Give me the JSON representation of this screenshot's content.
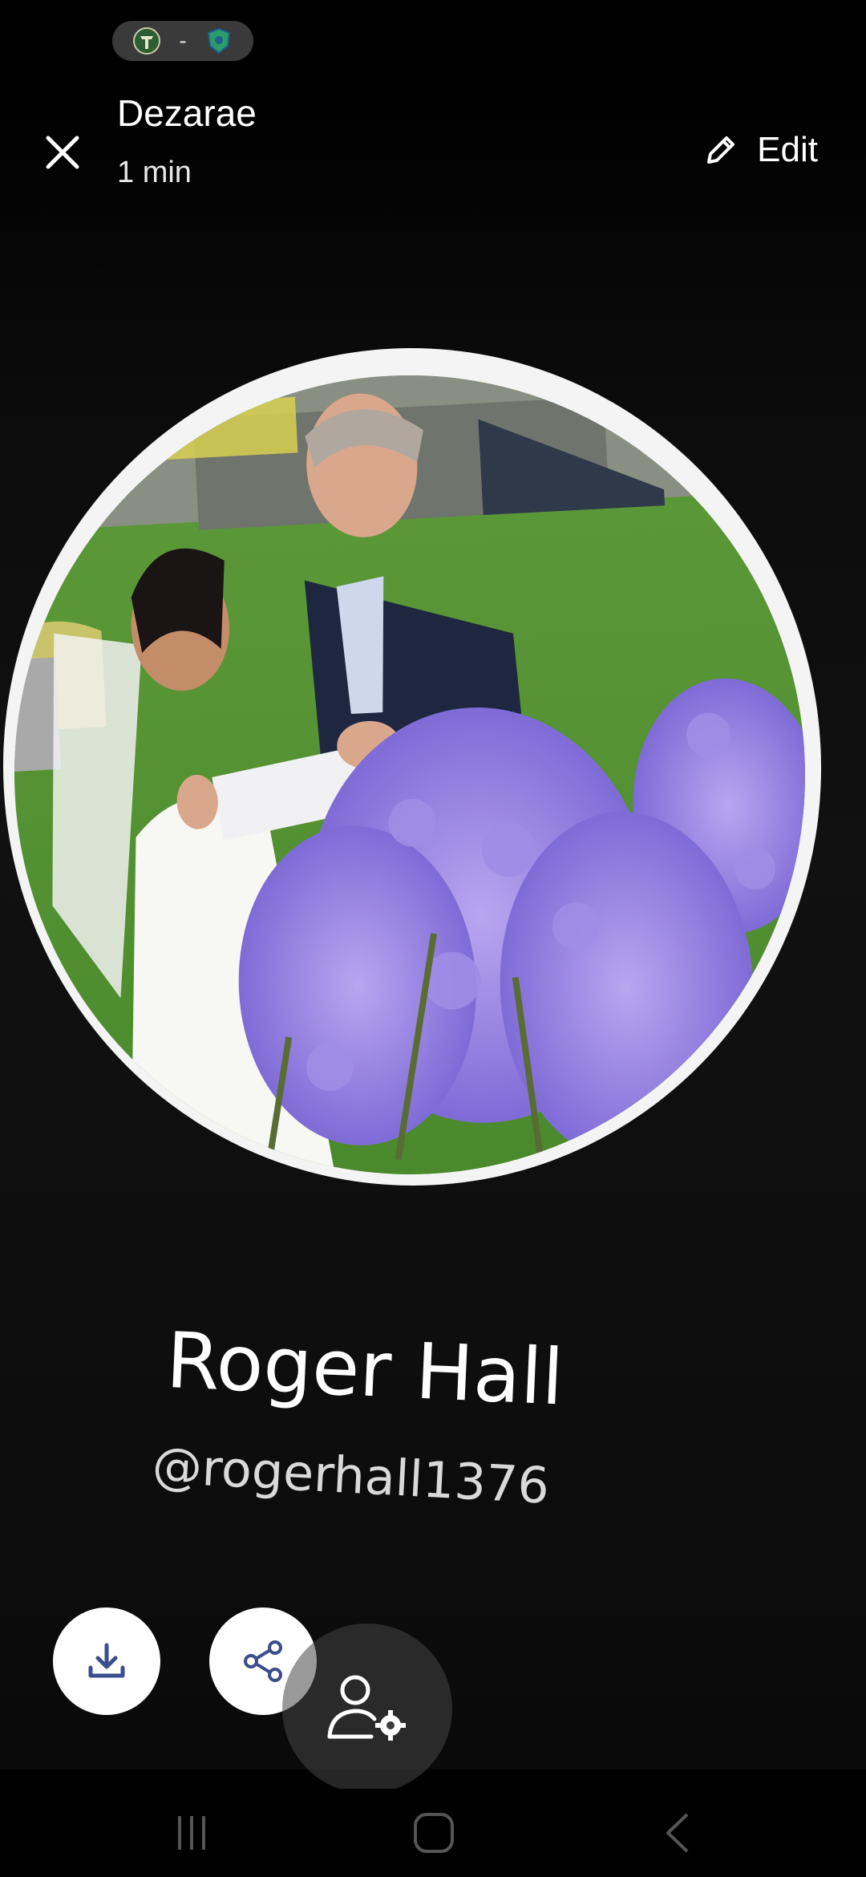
{
  "status_bar": {
    "icons": [
      "timbers-logo-icon",
      "sounders-logo-icon"
    ],
    "separator": "-"
  },
  "header": {
    "close_icon": "close-icon",
    "sender": "Dezarae",
    "time": "1 min",
    "edit_label": "Edit",
    "edit_icon": "pencil-icon"
  },
  "profile": {
    "name": "Roger Hall",
    "handle": "@rogerhall1376",
    "photo": "wedding-couple-photo"
  },
  "actions": {
    "download_icon": "download-icon",
    "share_icon": "share-icon",
    "manage_icon": "person-settings-icon"
  },
  "nav": {
    "recents_icon": "recents-icon",
    "home_icon": "home-icon",
    "back_icon": "back-icon"
  },
  "colors": {
    "background": "#000000",
    "button_bg": "#ffffff",
    "icon_accent": "#3a4e8c",
    "avatar_ring": "#f4f4f4"
  }
}
